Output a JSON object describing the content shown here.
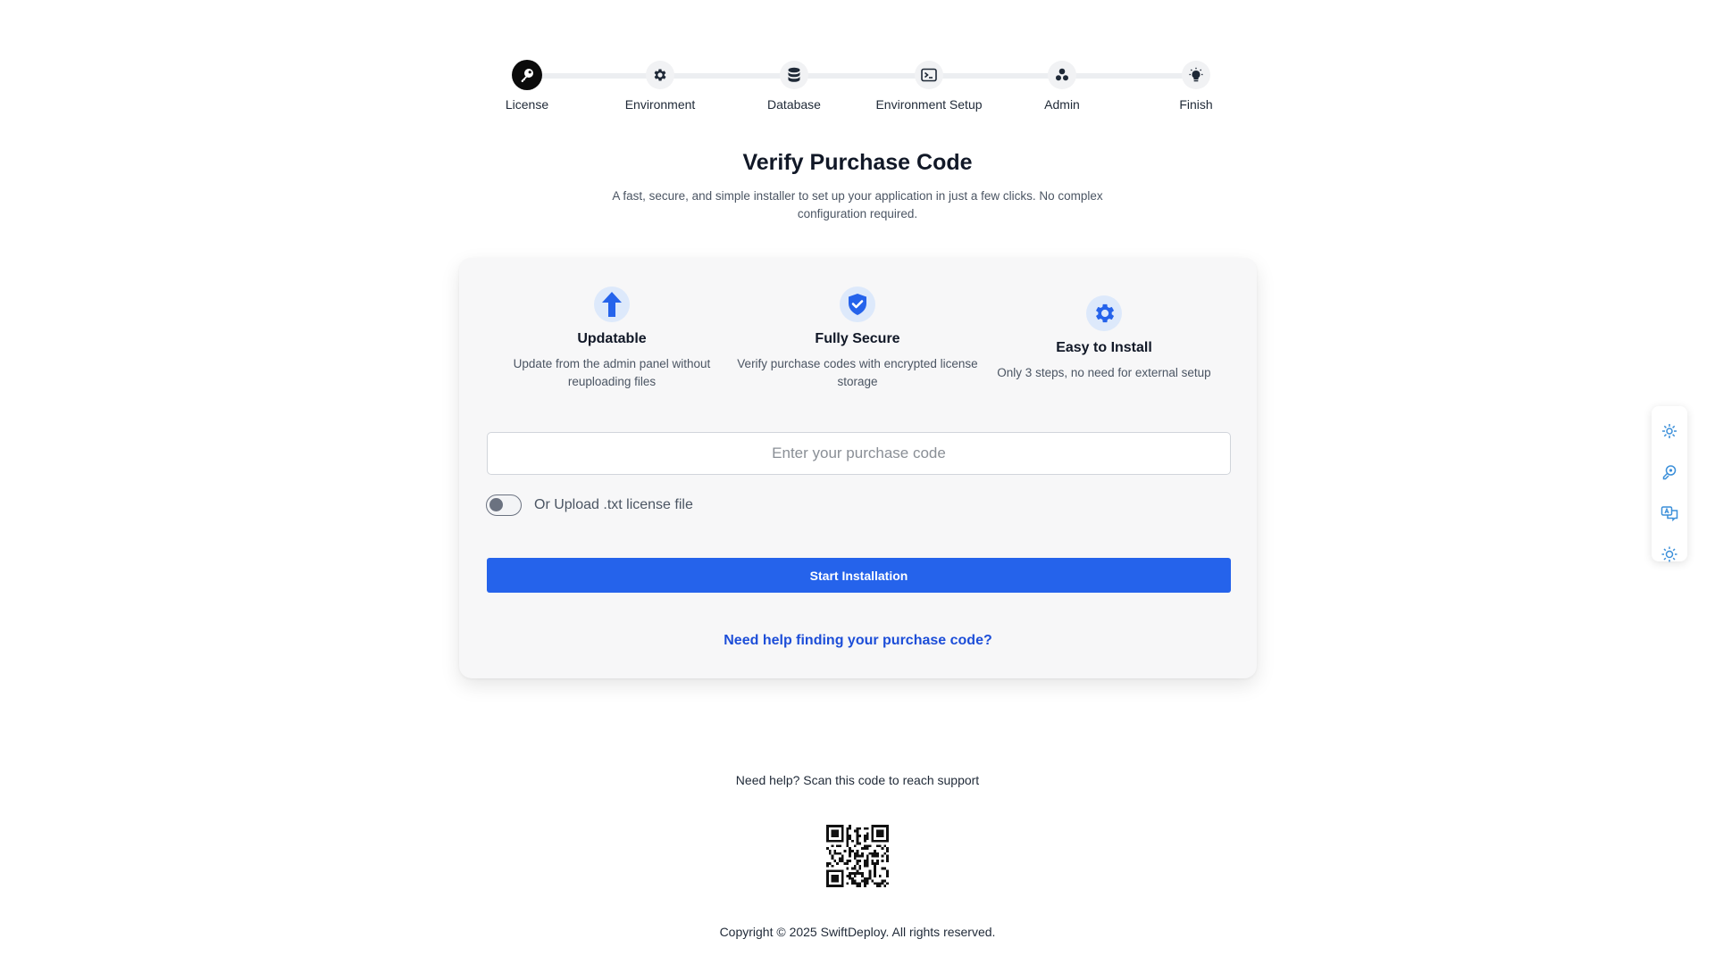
{
  "stepper": {
    "steps": [
      {
        "label": "License",
        "icon": "key-icon",
        "active": true
      },
      {
        "label": "Environment",
        "icon": "gear-icon",
        "active": false
      },
      {
        "label": "Database",
        "icon": "database-icon",
        "active": false
      },
      {
        "label": "Environment Setup",
        "icon": "terminal-icon",
        "active": false
      },
      {
        "label": "Admin",
        "icon": "admin-users-icon",
        "active": false
      },
      {
        "label": "Finish",
        "icon": "lightbulb-icon",
        "active": false
      }
    ]
  },
  "header": {
    "title": "Verify Purchase Code",
    "subtitle": "A fast, secure, and simple installer to set up your application in just a few clicks. No complex configuration required."
  },
  "features": [
    {
      "title": "Updatable",
      "description": "Update from the admin panel without reuploading files",
      "icon": "upload-arrow-icon"
    },
    {
      "title": "Fully Secure",
      "description": "Verify purchase codes with encrypted license storage",
      "icon": "shield-check-icon"
    },
    {
      "title": "Easy to Install",
      "description": "Only 3 steps, no need for external setup",
      "icon": "gear-icon"
    }
  ],
  "form": {
    "purchase_code_value": "",
    "purchase_code_placeholder": "Enter your purchase code",
    "upload_toggle_label": "Or Upload .txt license file",
    "upload_toggle_on": false,
    "start_button_label": "Start Installation",
    "help_link_label": "Need help finding your purchase code?"
  },
  "footer": {
    "support_text": "Need help? Scan this code to reach support",
    "copyright": "Copyright © 2025 SwiftDeploy. All rights reserved."
  },
  "side_toolbar": {
    "items": [
      "network-settings-icon",
      "palette-link-icon",
      "translate-icon",
      "sun-theme-icon"
    ]
  },
  "colors": {
    "accent": "#2563eb",
    "link": "#1d4ed8",
    "card_bg": "#f7f7f8",
    "feature_icon_bg": "#dde9fb",
    "active_step": "#0b0b0b",
    "toolbar_icon": "#3b8fd9"
  }
}
